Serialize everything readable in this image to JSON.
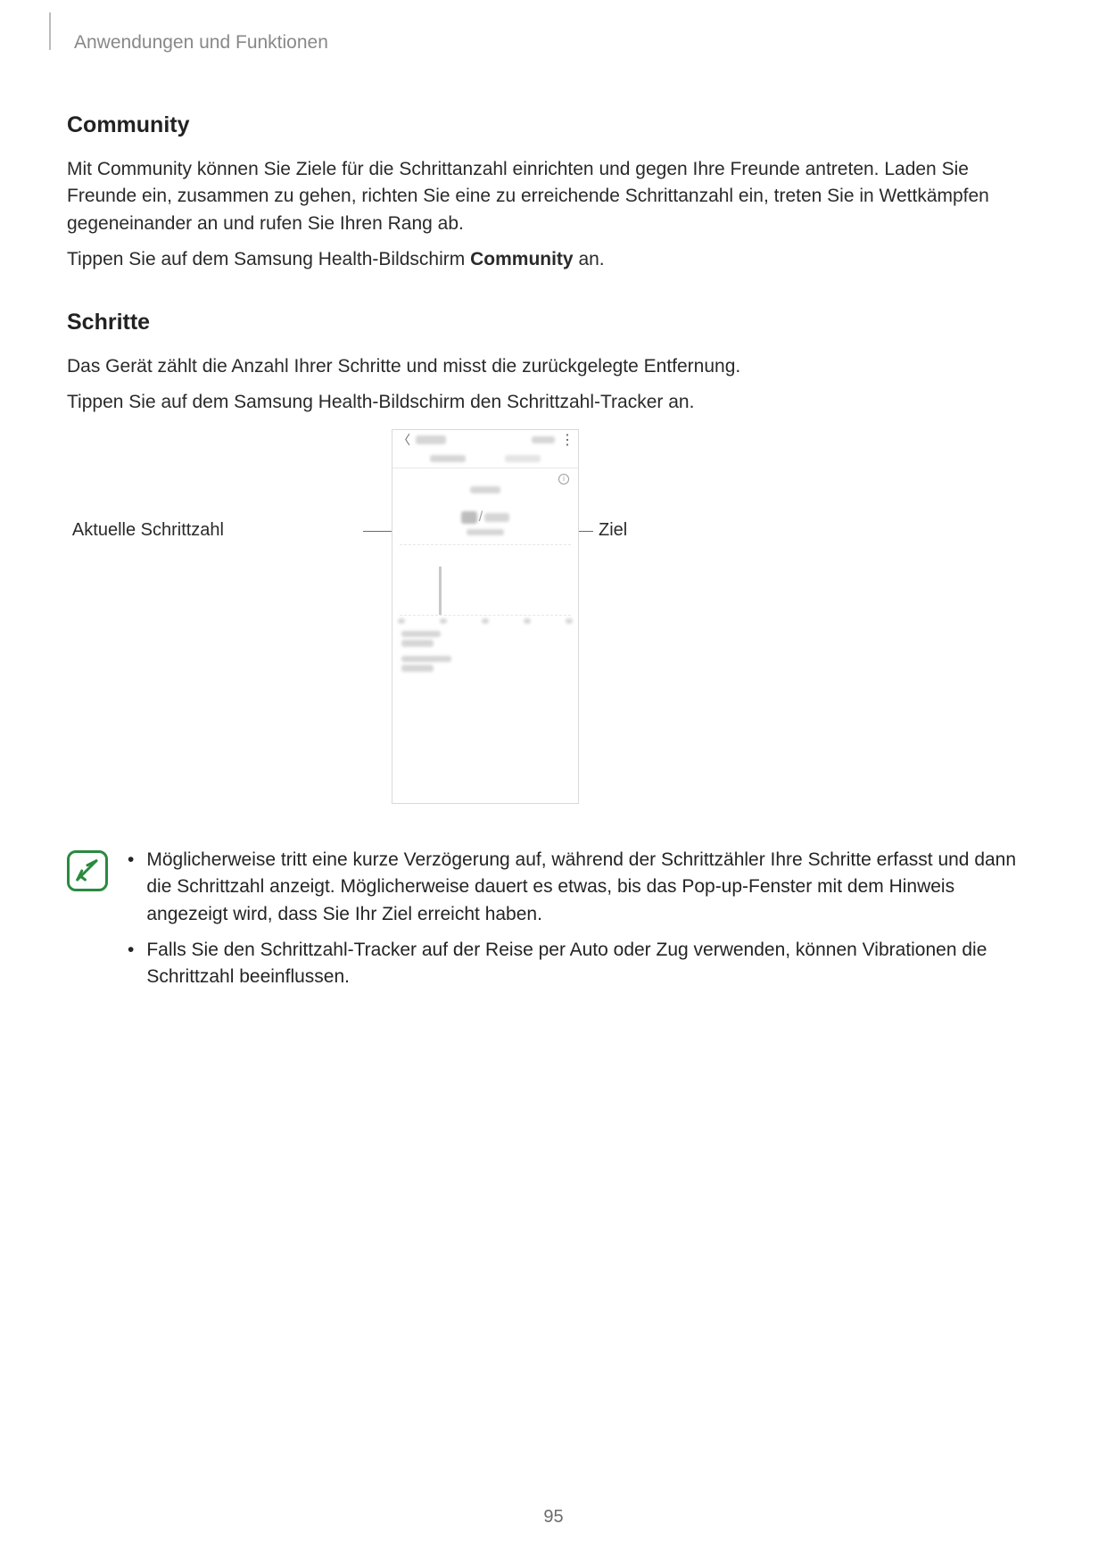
{
  "header": "Anwendungen und Funktionen",
  "community": {
    "heading": "Community",
    "p1": "Mit Community können Sie Ziele für die Schrittanzahl einrichten und gegen Ihre Freunde antreten. Laden Sie Freunde ein, zusammen zu gehen, richten Sie eine zu erreichende Schrittanzahl ein, treten Sie in Wettkämpfen gegeneinander an und rufen Sie Ihren Rang ab.",
    "p2_pre": "Tippen Sie auf dem Samsung Health-Bildschirm ",
    "p2_bold": "Community",
    "p2_post": " an."
  },
  "schritte": {
    "heading": "Schritte",
    "p1": "Das Gerät zählt die Anzahl Ihrer Schritte und misst die zurückgelegte Entfernung.",
    "p2": "Tippen Sie auf dem Samsung Health-Bildschirm den Schrittzahl-Tracker an."
  },
  "callouts": {
    "left": "Aktuelle Schrittzahl",
    "right": "Ziel"
  },
  "phone": {
    "slash": "/",
    "info_glyph": "i"
  },
  "notes": {
    "item1": "Möglicherweise tritt eine kurze Verzögerung auf, während der Schrittzähler Ihre Schritte erfasst und dann die Schrittzahl anzeigt. Möglicherweise dauert es etwas, bis das Pop-up-Fenster mit dem Hinweis angezeigt wird, dass Sie Ihr Ziel erreicht haben.",
    "item2": "Falls Sie den Schrittzahl-Tracker auf der Reise per Auto oder Zug verwenden, können Vibrationen die Schrittzahl beeinflussen."
  },
  "bullet": "•",
  "page_number": "95"
}
